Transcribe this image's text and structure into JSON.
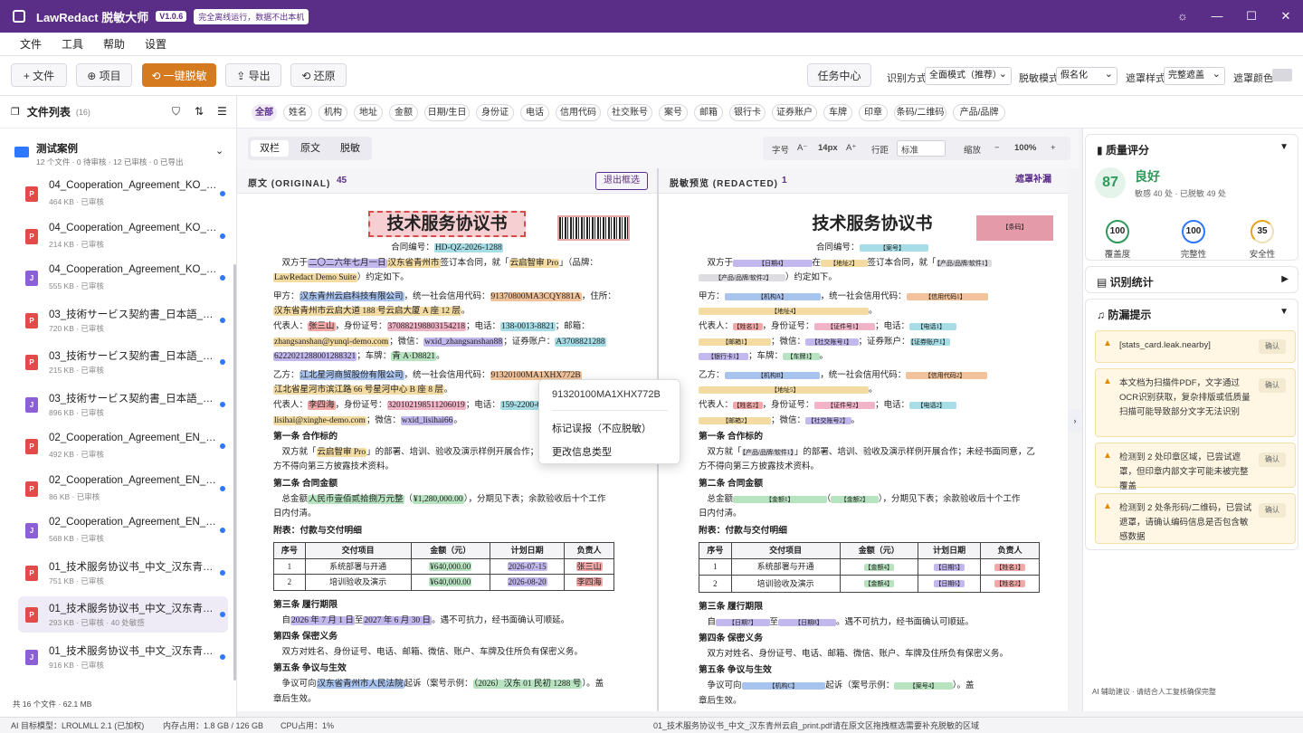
{
  "app": {
    "name": "LawRedact 脱敏大师",
    "version": "V1.0.6",
    "tagline": "完全离线运行，数据不出本机"
  },
  "menu": [
    "文件",
    "工具",
    "帮助",
    "设置"
  ],
  "toolbar": {
    "file": "+ 文件",
    "project": "⊕ 项目",
    "one_click": "⟲ 一键脱敏",
    "export": "⇪ 导出",
    "restore": "⟲ 还原",
    "task_center": "任务中心",
    "recog_label": "识别方式",
    "recog_value": "全面模式（推荐）",
    "mode_label": "脱敏模式",
    "mode_value": "假名化",
    "mask_label": "遮罩样式",
    "mask_value": "完整遮盖",
    "color_label": "遮罩颜色:"
  },
  "sidebar": {
    "title": "文件列表",
    "count": "(16)",
    "folder_name": "测试案例",
    "folder_meta": "12 个文件 · 0 待审核 · 12 已审核 · 0 已导出",
    "files": [
      {
        "name": "04_Cooperation_Agreement_KO_Ch...",
        "meta": "464 KB · 已审核",
        "type": "P",
        "color": "#e34b4b"
      },
      {
        "name": "04_Cooperation_Agreement_KO_Ch...",
        "meta": "214 KB · 已审核",
        "type": "P",
        "color": "#e34b4b"
      },
      {
        "name": "04_Cooperation_Agreement_KO_Ch...",
        "meta": "555 KB · 已审核",
        "type": "J",
        "color": "#8b5fd6"
      },
      {
        "name": "03_技術サービス契約書_日本語_青州...",
        "meta": "720 KB · 已审核",
        "type": "P",
        "color": "#e34b4b"
      },
      {
        "name": "03_技術サービス契約書_日本語_青州...",
        "meta": "215 KB · 已审核",
        "type": "P",
        "color": "#e34b4b"
      },
      {
        "name": "03_技術サービス契約書_日本語_青州...",
        "meta": "896 KB · 已审核",
        "type": "J",
        "color": "#8b5fd6"
      },
      {
        "name": "02_Cooperation_Agreement_EN_Eas...",
        "meta": "492 KB · 已审核",
        "type": "P",
        "color": "#e34b4b"
      },
      {
        "name": "02_Cooperation_Agreement_EN_Eas...",
        "meta": "86 KB · 已审核",
        "type": "P",
        "color": "#e34b4b"
      },
      {
        "name": "02_Cooperation_Agreement_EN_Eas...",
        "meta": "568 KB · 已审核",
        "type": "J",
        "color": "#8b5fd6"
      },
      {
        "name": "01_技术服务协议书_中文_汉东青州云...",
        "meta": "751 KB · 已审核",
        "type": "P",
        "color": "#e34b4b"
      },
      {
        "name": "01_技术服务协议书_中文_汉东青州云...",
        "meta": "293 KB · 已审核 · 40 处敏感",
        "type": "P",
        "color": "#e34b4b"
      },
      {
        "name": "01_技术服务协议书_中文_汉东青州云...",
        "meta": "916 KB · 已审核",
        "type": "J",
        "color": "#8b5fd6"
      }
    ],
    "footer": "共 16 个文件 · 62.1 MB"
  },
  "tags": [
    "全部",
    "姓名",
    "机构",
    "地址",
    "金额",
    "日期/生日",
    "身份证",
    "电话",
    "信用代码",
    "社交账号",
    "案号",
    "邮箱",
    "银行卡",
    "证券账户",
    "车牌",
    "印章",
    "条码/二维码",
    "产品/品牌"
  ],
  "view": {
    "tabs": [
      "双栏",
      "原文",
      "脱敏"
    ],
    "font_label": "字号",
    "font_dec": "A⁻",
    "font_size": "14px",
    "font_inc": "A⁺",
    "line_label": "行距",
    "line_value": "标准",
    "zoom_label": "缩放",
    "zoom_dec": "−",
    "zoom_value": "100%",
    "zoom_inc": "+"
  },
  "left_pane": {
    "title": "原文 (ORIGINAL)",
    "count": "45",
    "button": "退出框选"
  },
  "right_pane": {
    "title": "脱敏预览 (REDACTED)",
    "count": "1",
    "button": "遮罩补漏"
  },
  "doc": {
    "title": "技术服务协议书",
    "contract_no_label": "合同编号：",
    "contract_no": "HD-QZ-2026-1288",
    "date": "二〇二六年七月一日",
    "city": "汉东省青州市",
    "product": "云启智审 Pro",
    "brand": "LawRedact Demo Suite",
    "party_a": "汉东青州云启科技有限公司",
    "credit_a": "91370800MA3CQY881A",
    "addr_a": "汉东省青州市云启大道 188 号云启大厦 A 座 12 层",
    "rep_a": "张三山",
    "id_a": "370882198803154218",
    "tel_a": "138-0013-8821",
    "mail_a": "zhangsanshan@yunqi-demo.com",
    "wx_a": "wxid_zhangsanshan88",
    "sec_a": "A3708821288",
    "bank_a": "6222021288001288321",
    "plate_a": "青 A·D8821",
    "party_b": "江北星河商贸股份有限公司",
    "credit_b": "91320100MA1XHX772B",
    "addr_b": "江北省星河市滨江路 66 号星河中心 B 座 8 层",
    "rep_b": "李四海",
    "id_b": "320102198511206019",
    "tel_b": "159-2200-6",
    "mail_b": "lisihai@xinghe-demo.com",
    "wx_b": "wxid_lisihai66",
    "amount_cn": "人民币壹佰贰拾捌万元整",
    "amount": "¥1,280,000.00",
    "start": "2026 年 7 月 1 日",
    "end": "2027 年 6 月 30 日",
    "court": "汉东省青州市人民法院",
    "case": "（2026）汉东 01 民初 1288 号"
  },
  "table": {
    "headers": [
      "序号",
      "交付项目",
      "金额（元）",
      "计划日期",
      "负责人"
    ],
    "rows": [
      [
        "1",
        "系统部署与开通",
        "¥640,000.00",
        "2026-07-15",
        "张三山"
      ],
      [
        "2",
        "培训验收及演示",
        "¥640,000.00",
        "2026-08-20",
        "李四海"
      ]
    ]
  },
  "redacted": {
    "contract_no": "【案号】",
    "seal": "【条码】",
    "date": "【日期4】",
    "city": "【地址2】",
    "product": "【产品/品牌/软件1】",
    "brand": "【产品/品牌/软件2】",
    "party_a": "【机构A】",
    "credit_a": "【信用代码1】",
    "addr_a": "【地址4】",
    "rep_a": "【姓名1】",
    "id_a": "【证件号1】",
    "tel_a": "【电话1】",
    "mail_a": "【邮箱1】",
    "wx_a": "【社交账号1】",
    "sec_a": "【证券账户1】",
    "bank_a": "【银行卡1】",
    "plate_a": "【车牌1】",
    "party_b": "【机构B】",
    "credit_b": "【信用代码2】",
    "addr_b": "【地址5】",
    "rep_b": "【姓名2】",
    "id_b": "【证件号2】",
    "tel_b": "【电话2】",
    "mail_b": "【邮箱2】",
    "wx_b": "【社交账号2】",
    "amt1": "【金额1】",
    "amt2": "【金额2】",
    "amt4": "【金额4】",
    "d5": "【日期5】",
    "d6": "【日期6】",
    "n1": "【姓名1】",
    "n2": "【姓名2】",
    "d7": "【日期7】",
    "d8": "【日期8】",
    "court": "【机构C】",
    "case": "【案号4】"
  },
  "doc_text": {
    "l1a": "双方于",
    "l1b": "在",
    "l1c": "签订本合同，就「",
    "l1d": "」（品牌：",
    "l2": "）约定如下。",
    "jia": "甲方：",
    "credit_label": "，统一社会信用代码：",
    "addr_label": "，住所：",
    "rep_label": "代表人：",
    "id_label": "，身份证号：",
    "tel_label": "；电话：",
    "mail_label": "；邮箱：",
    "wx_label": "；微信：",
    "sec_label": "；证券账户：",
    "bank_label": "；银行账户：",
    "plate_label": "；车牌：",
    "yi": "乙方：",
    "s1": "第一条  合作标的",
    "s1t_a": "双方就「",
    "s1t_b": "」的部署、培训、验收及演示样例开展合作；未经书面同意，乙",
    "s1t_c": "方不得向第三方披露技术资料。",
    "s2": "第二条  合同金额",
    "s2t_a": "总金额",
    "s2t_b": "，分期见下表；余款验收后十个工作",
    "s2t_c": "日内付清。",
    "tbl_title": "附表：付款与交付明细",
    "s3": "第三条  履行期限",
    "s3t_a": "自",
    "s3t_b": "至",
    "s3t_c": "。遇不可抗力，经书面确认可顺延。",
    "s4": "第四条  保密义务",
    "s4t": "双方对姓名、身份证号、电话、邮箱、微信、账户、车牌及住所负有保密义务。",
    "s5": "第五条  争议与生效",
    "s5t_a": "争议可向",
    "s5t_b": "起诉（案号示例：",
    "s5t_c": "）。盖",
    "s5t_d": "章后生效。"
  },
  "context_menu": {
    "value": "91320100MA1XHX772B",
    "mark": "标记误报（不应脱敏）",
    "change": "更改信息类型"
  },
  "quality": {
    "title": "质量评分",
    "score": "87",
    "grade": "良好",
    "detail": "敏感 40 处 · 已脱敏 49 处",
    "metrics": [
      {
        "label": "覆盖度",
        "value": "100",
        "color": "#2e9a5a"
      },
      {
        "label": "完整性",
        "value": "100",
        "color": "#2e77ff"
      },
      {
        "label": "安全性",
        "value": "35",
        "color": "#e7a21a"
      }
    ]
  },
  "stats": {
    "title": "识别统计"
  },
  "leak": {
    "title": "防漏提示",
    "items": [
      "[stats_card.leak.nearby]",
      "本文档为扫描件PDF，文字通过OCR识别获取，复杂排版或低质量扫描可能导致部分文字无法识别",
      "检测到 2 处印章区域，已尝试遮罩，但印章内部文字可能未被完整覆盖",
      "检测到 2 处条形码/二维码，已尝试遮罩，请确认编码信息是否包含敏感数据"
    ],
    "confirm": "确认"
  },
  "right_footer": "AI 辅助建议 · 请结合人工复核确保完整",
  "status": {
    "model": "AI 目标模型：LROLMLL 2.1 (已加权)",
    "mem": "内存占用：1.8 GB / 126 GB",
    "cpu": "CPU占用：1%",
    "file": "01_技术服务协议书_中文_汉东青州云启_print.pdf",
    "hint": "请在原文区拖拽框选需要补充脱敏的区域"
  },
  "colors": {
    "brand": "#5a2d86",
    "accent": "#d67a1f"
  }
}
